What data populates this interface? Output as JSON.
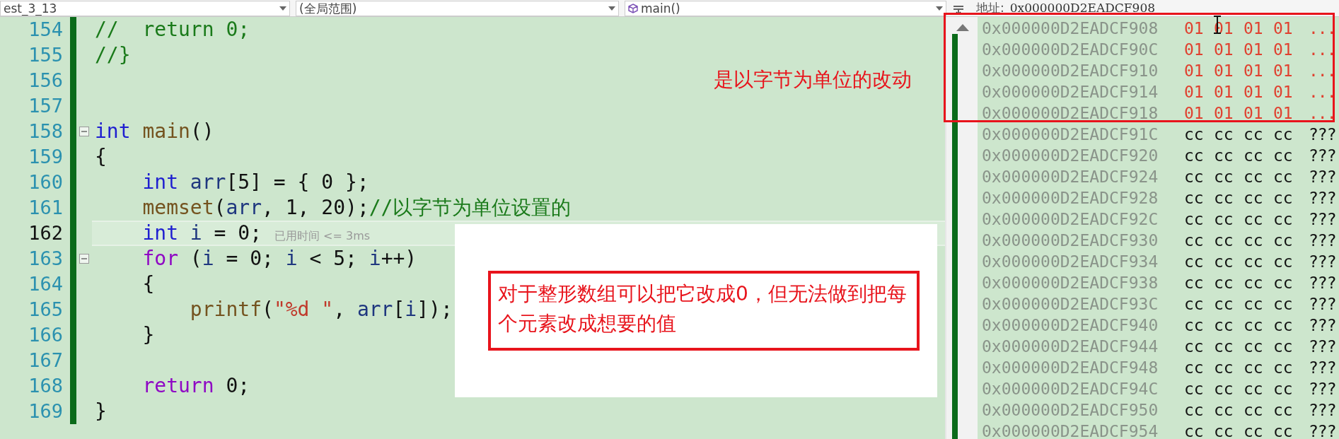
{
  "toolbar": {
    "dropdowns": [
      {
        "text": "est_3_13",
        "icon": false
      },
      {
        "text": "(全局范围)",
        "icon": false
      },
      {
        "text": "main()",
        "icon": true
      }
    ],
    "address_label": "地址:",
    "address_value": "0x000000D2EADCF908"
  },
  "editor": {
    "lines": [
      {
        "number": "154",
        "current": false,
        "foldable": false,
        "tokens": [
          {
            "kind": "comment",
            "text": "//  return 0;"
          }
        ]
      },
      {
        "number": "155",
        "current": false,
        "foldable": false,
        "tokens": [
          {
            "kind": "comment",
            "text": "//}"
          }
        ]
      },
      {
        "number": "156",
        "current": false,
        "foldable": false
      },
      {
        "number": "157",
        "current": false,
        "foldable": false
      },
      {
        "number": "158",
        "current": false,
        "foldable": true,
        "tokens": [
          {
            "kind": "keyword",
            "text": "int "
          },
          {
            "kind": "function",
            "text": "main"
          },
          {
            "kind": "plain",
            "text": "()"
          }
        ]
      },
      {
        "number": "159",
        "current": false,
        "foldable": false,
        "tokens": [
          {
            "kind": "plain",
            "text": "{"
          }
        ]
      },
      {
        "number": "160",
        "current": false,
        "foldable": false,
        "tokens": [
          {
            "kind": "keyword",
            "text": "    int "
          },
          {
            "kind": "variable",
            "text": "arr"
          },
          {
            "kind": "plain",
            "text": "[5] = { 0 };"
          }
        ]
      },
      {
        "number": "161",
        "current": false,
        "foldable": false,
        "tokens": [
          {
            "kind": "function",
            "text": "    memset"
          },
          {
            "kind": "plain",
            "text": "("
          },
          {
            "kind": "variable",
            "text": "arr"
          },
          {
            "kind": "plain",
            "text": ", 1, 20);"
          },
          {
            "kind": "comment",
            "text": "//以字节为单位设置的"
          }
        ]
      },
      {
        "number": "162",
        "current": true,
        "foldable": false,
        "tokens": [
          {
            "kind": "keyword",
            "text": "    int "
          },
          {
            "kind": "variable",
            "text": "i"
          },
          {
            "kind": "plain",
            "text": " = 0;"
          }
        ],
        "hint": "已用时间 <= 3ms"
      },
      {
        "number": "163",
        "current": false,
        "foldable": true,
        "tokens": [
          {
            "kind": "control",
            "text": "    for"
          },
          {
            "kind": "plain",
            "text": " ("
          },
          {
            "kind": "variable",
            "text": "i"
          },
          {
            "kind": "plain",
            "text": " = 0; "
          },
          {
            "kind": "variable",
            "text": "i"
          },
          {
            "kind": "plain",
            "text": " < 5; "
          },
          {
            "kind": "variable",
            "text": "i"
          },
          {
            "kind": "plain",
            "text": "++)"
          }
        ]
      },
      {
        "number": "164",
        "current": false,
        "foldable": false,
        "tokens": [
          {
            "kind": "plain",
            "text": "    {"
          }
        ]
      },
      {
        "number": "165",
        "current": false,
        "foldable": false,
        "tokens": [
          {
            "kind": "function",
            "text": "        printf"
          },
          {
            "kind": "plain",
            "text": "("
          },
          {
            "kind": "string",
            "text": "\"%d \""
          },
          {
            "kind": "plain",
            "text": ", "
          },
          {
            "kind": "variable",
            "text": "arr"
          },
          {
            "kind": "plain",
            "text": "["
          },
          {
            "kind": "variable",
            "text": "i"
          },
          {
            "kind": "plain",
            "text": "]);"
          }
        ]
      },
      {
        "number": "166",
        "current": false,
        "foldable": false,
        "tokens": [
          {
            "kind": "plain",
            "text": "    }"
          }
        ]
      },
      {
        "number": "167",
        "current": false,
        "foldable": false
      },
      {
        "number": "168",
        "current": false,
        "foldable": false,
        "tokens": [
          {
            "kind": "control",
            "text": "    return"
          },
          {
            "kind": "plain",
            "text": " 0;"
          }
        ]
      },
      {
        "number": "169",
        "current": false,
        "foldable": false,
        "tokens": [
          {
            "kind": "plain",
            "text": "}"
          }
        ]
      }
    ]
  },
  "memory": {
    "rows": [
      {
        "address": "0x000000D2EADCF908",
        "changed": true,
        "bytes": [
          "01",
          "01",
          "01",
          "01"
        ],
        "chars": "..."
      },
      {
        "address": "0x000000D2EADCF90C",
        "changed": true,
        "bytes": [
          "01",
          "01",
          "01",
          "01"
        ],
        "chars": "..."
      },
      {
        "address": "0x000000D2EADCF910",
        "changed": true,
        "bytes": [
          "01",
          "01",
          "01",
          "01"
        ],
        "chars": "..."
      },
      {
        "address": "0x000000D2EADCF914",
        "changed": true,
        "bytes": [
          "01",
          "01",
          "01",
          "01"
        ],
        "chars": "..."
      },
      {
        "address": "0x000000D2EADCF918",
        "changed": true,
        "bytes": [
          "01",
          "01",
          "01",
          "01"
        ],
        "chars": "..."
      },
      {
        "address": "0x000000D2EADCF91C",
        "changed": false,
        "bytes": [
          "cc",
          "cc",
          "cc",
          "cc"
        ],
        "chars": "???"
      },
      {
        "address": "0x000000D2EADCF920",
        "changed": false,
        "bytes": [
          "cc",
          "cc",
          "cc",
          "cc"
        ],
        "chars": "???"
      },
      {
        "address": "0x000000D2EADCF924",
        "changed": false,
        "bytes": [
          "cc",
          "cc",
          "cc",
          "cc"
        ],
        "chars": "???"
      },
      {
        "address": "0x000000D2EADCF928",
        "changed": false,
        "bytes": [
          "cc",
          "cc",
          "cc",
          "cc"
        ],
        "chars": "???"
      },
      {
        "address": "0x000000D2EADCF92C",
        "changed": false,
        "bytes": [
          "cc",
          "cc",
          "cc",
          "cc"
        ],
        "chars": "???"
      },
      {
        "address": "0x000000D2EADCF930",
        "changed": false,
        "bytes": [
          "cc",
          "cc",
          "cc",
          "cc"
        ],
        "chars": "???"
      },
      {
        "address": "0x000000D2EADCF934",
        "changed": false,
        "bytes": [
          "cc",
          "cc",
          "cc",
          "cc"
        ],
        "chars": "???"
      },
      {
        "address": "0x000000D2EADCF938",
        "changed": false,
        "bytes": [
          "cc",
          "cc",
          "cc",
          "cc"
        ],
        "chars": "???"
      },
      {
        "address": "0x000000D2EADCF93C",
        "changed": false,
        "bytes": [
          "cc",
          "cc",
          "cc",
          "cc"
        ],
        "chars": "???"
      },
      {
        "address": "0x000000D2EADCF940",
        "changed": false,
        "bytes": [
          "cc",
          "cc",
          "cc",
          "cc"
        ],
        "chars": "???"
      },
      {
        "address": "0x000000D2EADCF944",
        "changed": false,
        "bytes": [
          "cc",
          "cc",
          "cc",
          "cc"
        ],
        "chars": "???"
      },
      {
        "address": "0x000000D2EADCF948",
        "changed": false,
        "bytes": [
          "cc",
          "cc",
          "cc",
          "cc"
        ],
        "chars": "???"
      },
      {
        "address": "0x000000D2EADCF94C",
        "changed": false,
        "bytes": [
          "cc",
          "cc",
          "cc",
          "cc"
        ],
        "chars": "???"
      },
      {
        "address": "0x000000D2EADCF950",
        "changed": false,
        "bytes": [
          "cc",
          "cc",
          "cc",
          "cc"
        ],
        "chars": "???"
      },
      {
        "address": "0x000000D2EADCF954",
        "changed": false,
        "bytes": [
          "cc",
          "cc",
          "cc",
          "cc"
        ],
        "chars": "???"
      }
    ]
  },
  "memory_note": {
    "text": "是以字节为单位的改动"
  },
  "code_note": {
    "text": "对于整形数组可以把它改成0，但无法做到把每个元素改成想要的值"
  }
}
